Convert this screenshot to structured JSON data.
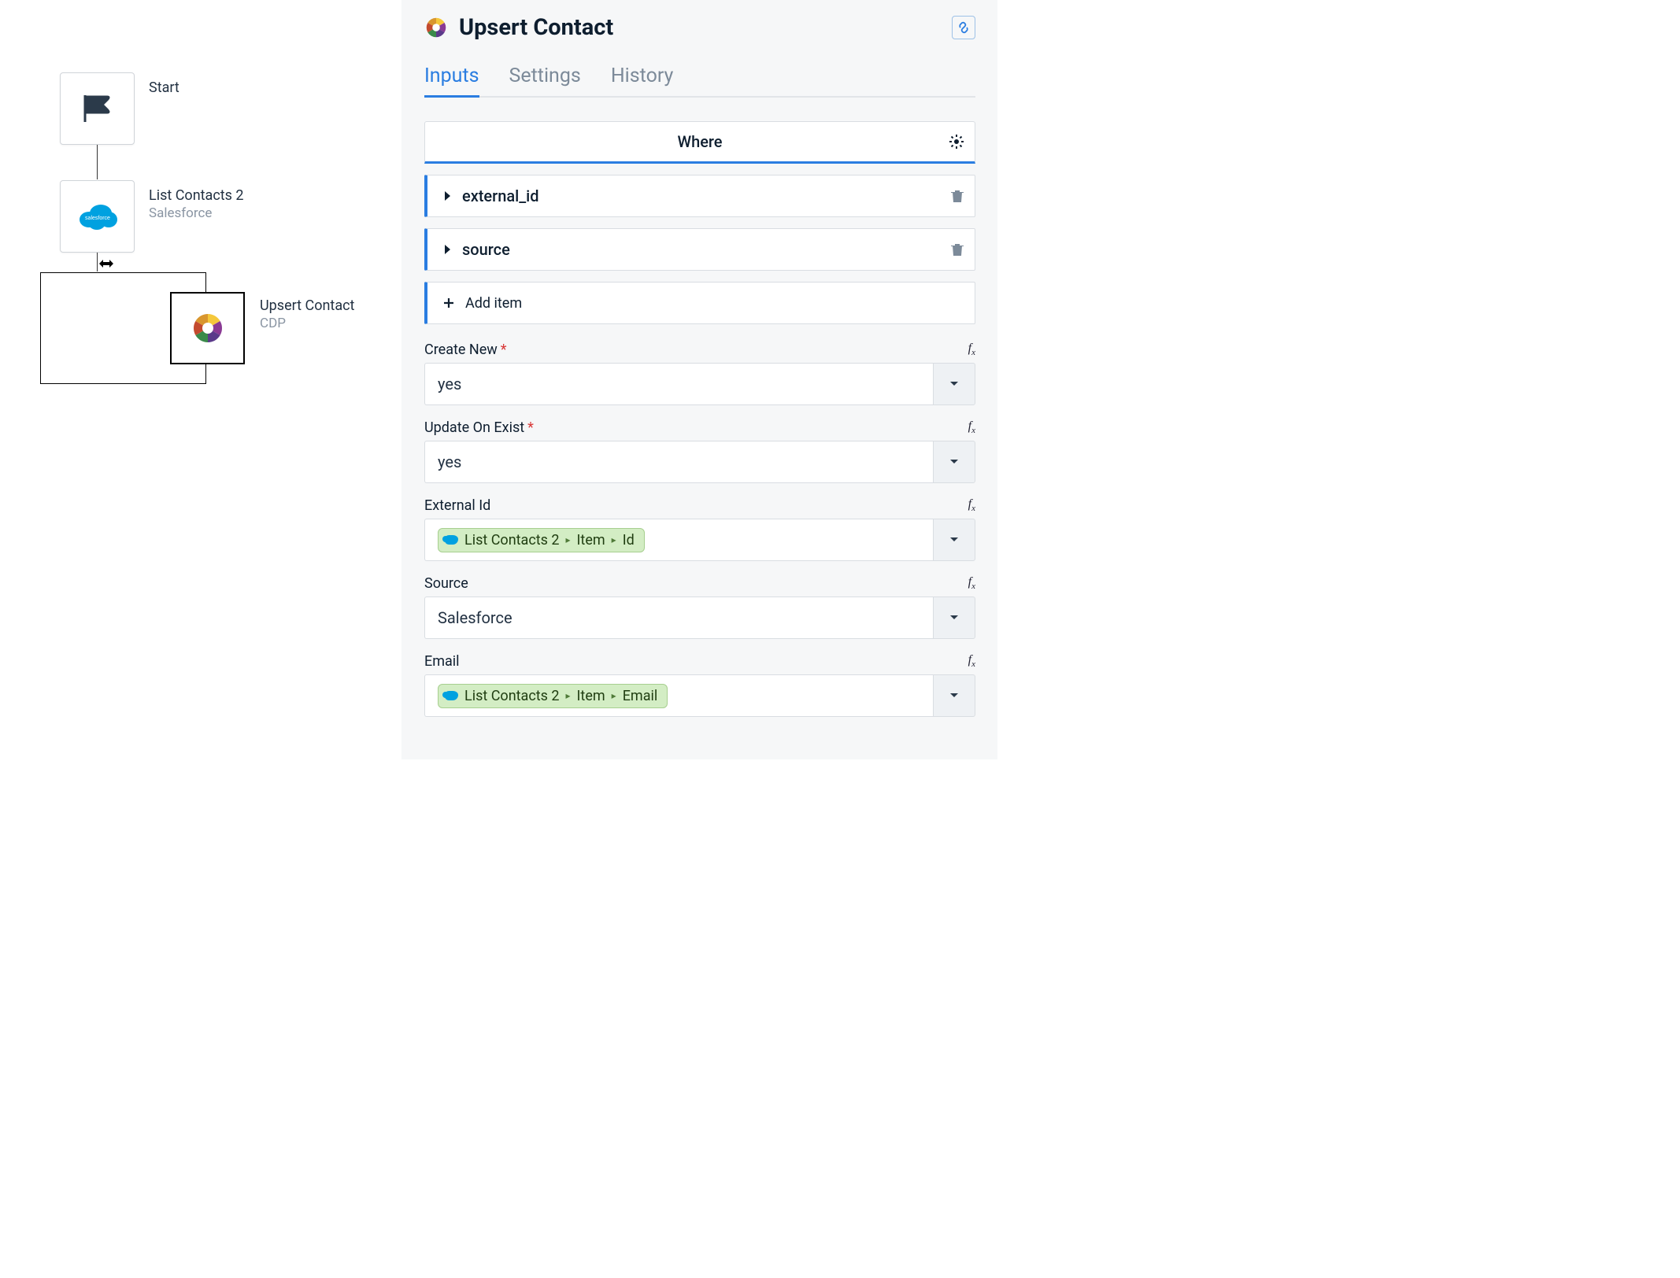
{
  "canvas": {
    "start_label": "Start",
    "node2_title": "List Contacts 2",
    "node2_sub": "Salesforce",
    "node3_title": "Upsert Contact",
    "node3_sub": "CDP"
  },
  "panel": {
    "title": "Upsert Contact",
    "tabs": {
      "inputs": "Inputs",
      "settings": "Settings",
      "history": "History"
    },
    "where": {
      "header": "Where",
      "items": [
        "external_id",
        "source"
      ],
      "add_item": "Add item"
    },
    "fields": {
      "create_new": {
        "label": "Create New",
        "required": true,
        "value": "yes"
      },
      "update_on_exist": {
        "label": "Update On Exist",
        "required": true,
        "value": "yes"
      },
      "external_id": {
        "label": "External Id",
        "pill_source": "List Contacts 2",
        "pill_seg1": "Item",
        "pill_seg2": "Id"
      },
      "source": {
        "label": "Source",
        "value": "Salesforce"
      },
      "email": {
        "label": "Email",
        "pill_source": "List Contacts 2",
        "pill_seg1": "Item",
        "pill_seg2": "Email"
      }
    },
    "fx_label": "fx"
  }
}
